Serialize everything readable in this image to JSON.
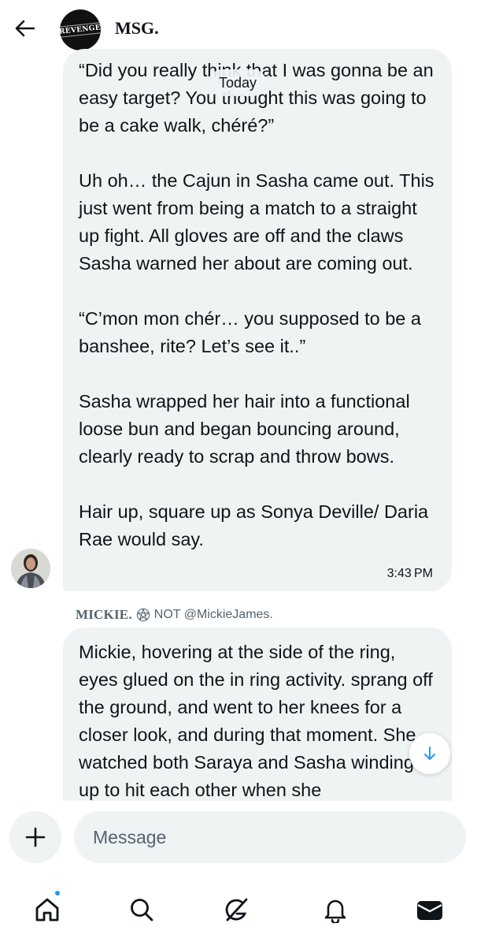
{
  "header": {
    "title": "MSG.",
    "avatar_text": "REVENGE"
  },
  "date_chip": "Today",
  "messages": [
    {
      "text": "“Did you really think that I was gonna be an easy target? You thought this was going to be a cake walk, chéré?”\n\nUh oh… the Cajun in Sasha came out. This just went from being a match to a straight up fight. All gloves are off and the claws Sasha warned her about are coming out.\n\n“C’mon mon chér… you supposed to be a banshee, rite? Let’s see it..”\n\nSasha wrapped her hair into a functional loose bun and began bouncing around, clearly ready to scrap and throw bows.\n\nHair up, square up as Sonya Deville/ Daria Rae would say.",
      "time": "3:43 PM"
    },
    {
      "sender": "MICKIE.",
      "sender_suffix": "NOT @MickieJames.",
      "text": "Mickie, hovering at the side of the ring, eyes glued on the in ring activity. sprang off the ground, and went to her knees for a closer look, and during that moment. She watched both Saraya and Sasha winding up to hit each other when she"
    }
  ],
  "composer": {
    "placeholder": "Message"
  },
  "nav": {
    "items": [
      "home-icon",
      "search-icon",
      "grok-icon",
      "notifications-icon",
      "messages-icon"
    ]
  },
  "colors": {
    "accent": "#1d9bf0",
    "bubble": "#eff3f4",
    "text": "#0f1419",
    "secondary": "#536471"
  }
}
